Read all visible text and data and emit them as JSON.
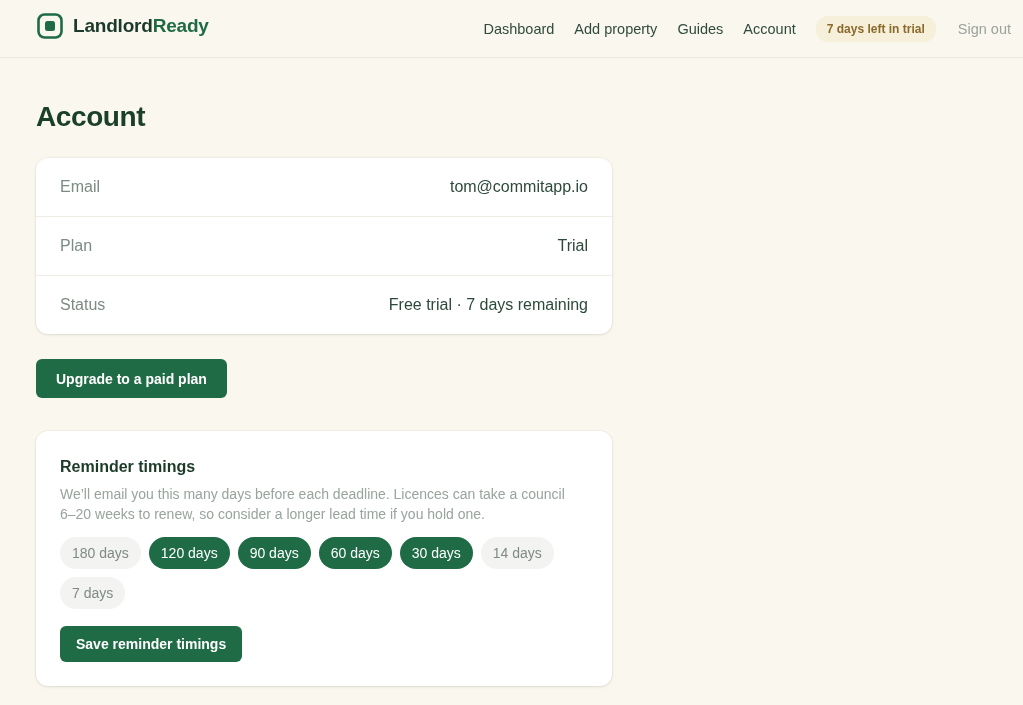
{
  "header": {
    "logo_parts": [
      "Landlord",
      "Ready"
    ],
    "nav": [
      "Dashboard",
      "Add property",
      "Guides",
      "Account"
    ],
    "trial_badge": "7 days left in trial",
    "sign_out": "Sign out"
  },
  "page": {
    "title": "Account"
  },
  "account_details": [
    {
      "label": "Email",
      "value": "tom@commitapp.io"
    },
    {
      "label": "Plan",
      "value": "Trial"
    },
    {
      "label": "Status",
      "value": "Free trial · 7 days remaining"
    }
  ],
  "upgrade_button": "Upgrade to a paid plan",
  "reminders": {
    "title": "Reminder timings",
    "description": "We’ll email you this many days before each deadline. Licences can take a council 6–20 weeks to renew, so consider a longer lead time if you hold one.",
    "options": [
      {
        "label": "180 days",
        "selected": false
      },
      {
        "label": "120 days",
        "selected": true
      },
      {
        "label": "90 days",
        "selected": true
      },
      {
        "label": "60 days",
        "selected": true
      },
      {
        "label": "30 days",
        "selected": true
      },
      {
        "label": "14 days",
        "selected": false
      },
      {
        "label": "7 days",
        "selected": false
      }
    ],
    "save_button": "Save reminder timings"
  }
}
